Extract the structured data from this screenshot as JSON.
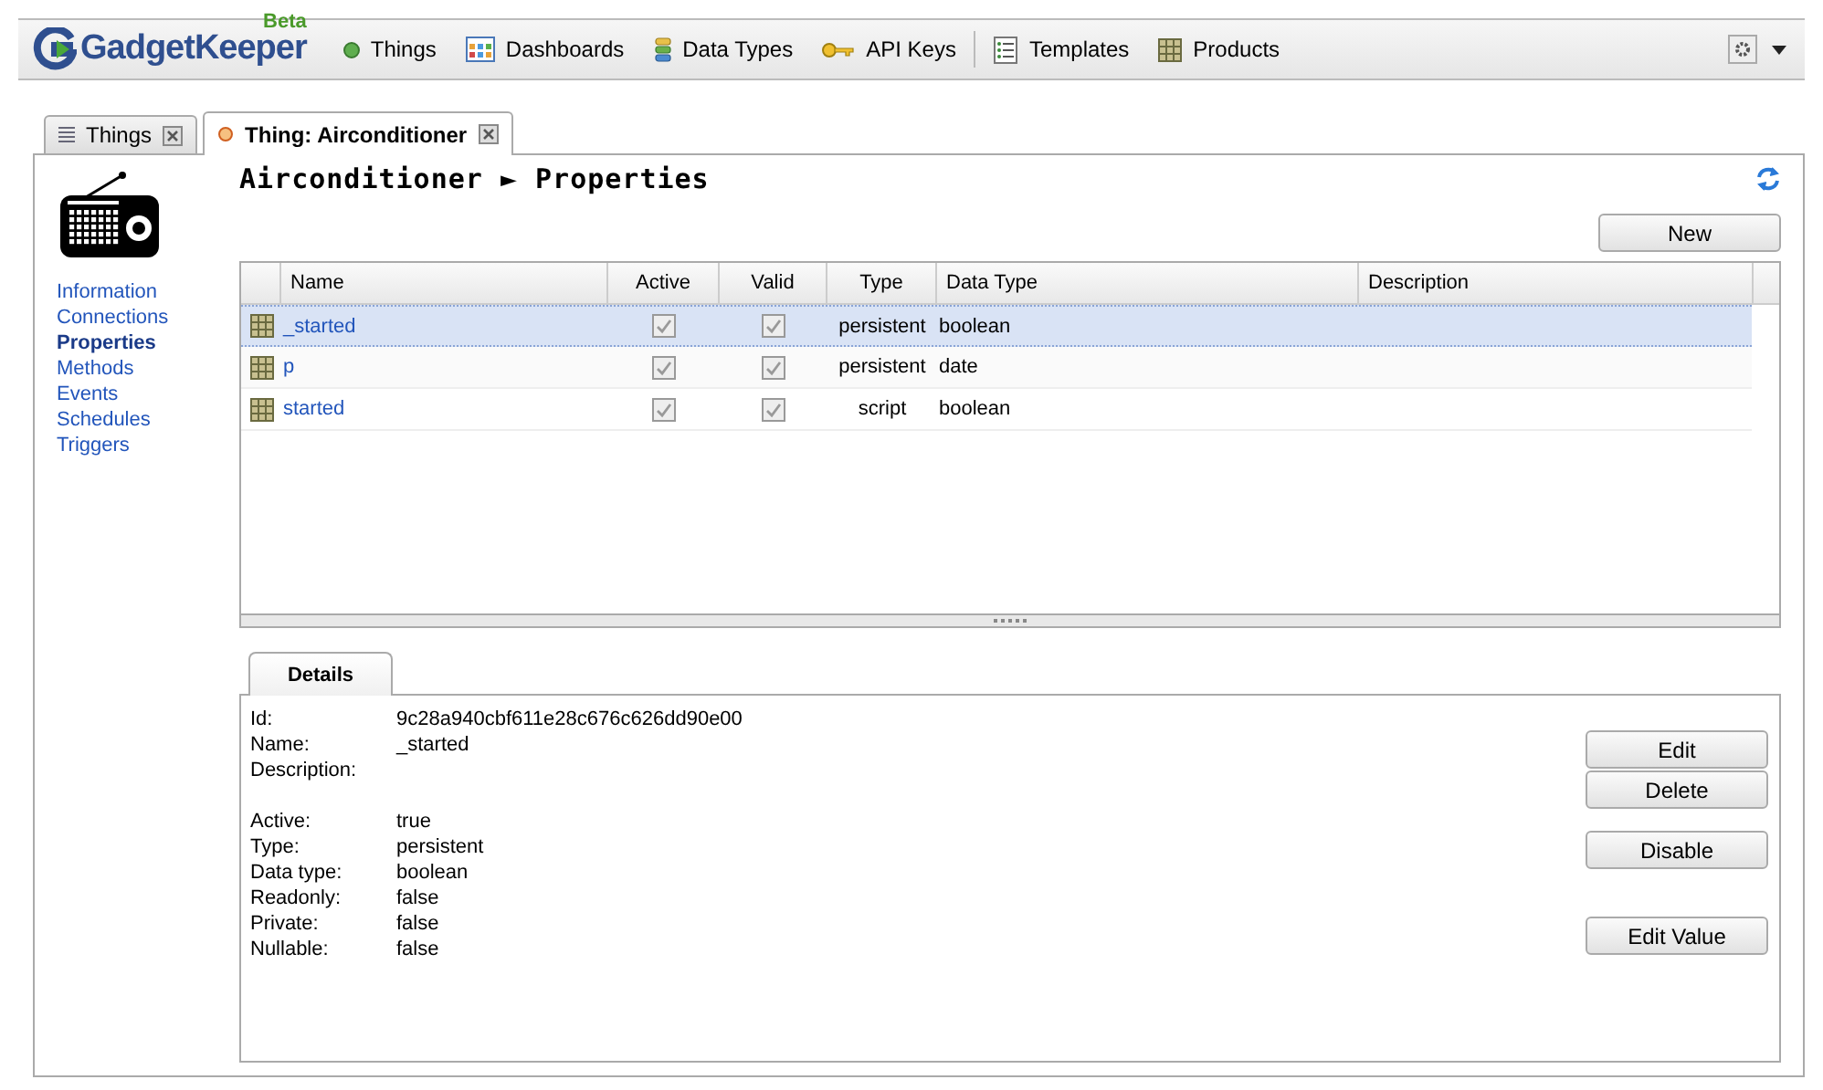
{
  "app": {
    "logo": "GadgetKeeper",
    "badge": "Beta"
  },
  "nav": [
    {
      "label": "Things"
    },
    {
      "label": "Dashboards"
    },
    {
      "label": "Data Types"
    },
    {
      "label": "API Keys"
    },
    {
      "label": "Templates"
    },
    {
      "label": "Products"
    }
  ],
  "tabs": [
    {
      "label": "Things",
      "selected": false
    },
    {
      "label": "Thing: Airconditioner",
      "selected": true
    }
  ],
  "page_title": "Airconditioner ► Properties",
  "sidebar": {
    "items": [
      {
        "label": "Information",
        "selected": false
      },
      {
        "label": "Connections",
        "selected": false
      },
      {
        "label": "Properties",
        "selected": true
      },
      {
        "label": "Methods",
        "selected": false
      },
      {
        "label": "Events",
        "selected": false
      },
      {
        "label": "Schedules",
        "selected": false
      },
      {
        "label": "Triggers",
        "selected": false
      }
    ]
  },
  "new_button": "New",
  "table": {
    "columns": [
      "Name",
      "Active",
      "Valid",
      "Type",
      "Data Type",
      "Description"
    ],
    "rows": [
      {
        "name": "_started",
        "active": true,
        "valid": true,
        "type": "persistent",
        "data_type": "boolean",
        "selected": true
      },
      {
        "name": "p",
        "active": true,
        "valid": true,
        "type": "persistent",
        "data_type": "date",
        "selected": false
      },
      {
        "name": "started",
        "active": true,
        "valid": true,
        "type": "script",
        "data_type": "boolean",
        "selected": false
      }
    ]
  },
  "details": {
    "tab": "Details",
    "groups": [
      [
        {
          "label": "Id:",
          "value": "9c28a940cbf611e28c676c626dd90e00"
        },
        {
          "label": "Name:",
          "value": "_started"
        },
        {
          "label": "Description:"
        }
      ],
      [
        {
          "label": "Active:",
          "value": "true"
        },
        {
          "label": "Type:",
          "value": "persistent"
        },
        {
          "label": "Data type:",
          "value": "boolean"
        },
        {
          "label": "Readonly:",
          "value": "false"
        },
        {
          "label": "Private:",
          "value": "false"
        },
        {
          "label": "Nullable:",
          "value": "false"
        }
      ]
    ],
    "button_groups": [
      [
        "Edit",
        "Delete"
      ],
      [
        "Disable"
      ],
      [
        "Edit Value"
      ]
    ]
  }
}
